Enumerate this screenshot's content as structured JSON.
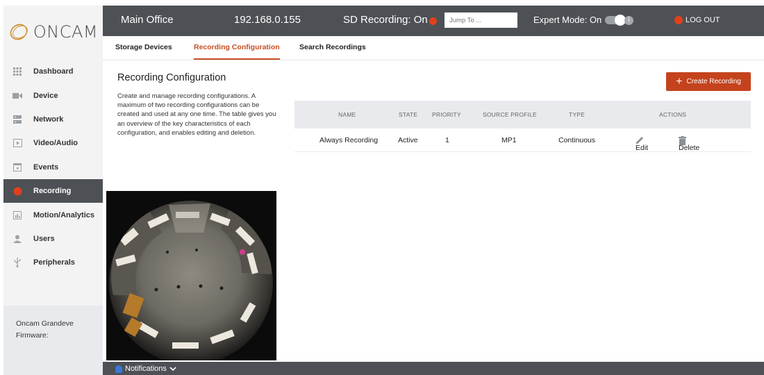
{
  "brand": {
    "logo_text": "ONCAM"
  },
  "sidebar": {
    "items": [
      {
        "label": "Dashboard",
        "icon": "dashboard-grid-icon",
        "active": false
      },
      {
        "label": "Device",
        "icon": "camera-icon",
        "active": false
      },
      {
        "label": "Network",
        "icon": "network-server-icon",
        "active": false
      },
      {
        "label": "Video/Audio",
        "icon": "video-play-icon",
        "active": false
      },
      {
        "label": "Events",
        "icon": "calendar-icon",
        "active": false
      },
      {
        "label": "Recording",
        "icon": "record-dot-icon",
        "active": true
      },
      {
        "label": "Motion/Analytics",
        "icon": "analytics-chart-icon",
        "active": false
      },
      {
        "label": "Users",
        "icon": "user-icon",
        "active": false
      },
      {
        "label": "Peripherals",
        "icon": "usb-icon",
        "active": false
      }
    ],
    "device_name": "Oncam Grandeve",
    "firmware_label": "Firmware:"
  },
  "header": {
    "site_name": "Main Office",
    "ip_address": "192.168.0.155",
    "sd_recording": "SD Recording: On",
    "jump_to_placeholder": "Jump To ...",
    "expert_mode": "Expert Mode: On",
    "logout": "LOG OUT"
  },
  "tabs": [
    {
      "label": "Storage Devices",
      "active": false
    },
    {
      "label": "Recording Configuration",
      "active": true
    },
    {
      "label": "Search Recordings",
      "active": false
    }
  ],
  "main": {
    "title": "Recording Configuration",
    "description": "Create and manage recording configurations. A maximum of two recording configurations can be created and used at any one time. The table gives you an overview of the key characteristics of each configuration, and enables editing and deletion.",
    "create_button": "Create Recording",
    "table": {
      "headers": [
        "NAME",
        "STATE",
        "PRIORITY",
        "SOURCE PROFILE",
        "TYPE",
        "ACTIONS"
      ],
      "rows": [
        {
          "name": "Always Recording",
          "state": "Active",
          "priority": "1",
          "source_profile": "MP1",
          "type": "Continuous",
          "edit": "Edit",
          "delete": "Delete"
        }
      ]
    }
  },
  "footer": {
    "notifications": "Notifications"
  },
  "colors": {
    "accent": "#c4431d",
    "header_bg": "#4d5155",
    "sidebar_bg": "#f3f3f3",
    "record_dot": "#e2401c"
  }
}
